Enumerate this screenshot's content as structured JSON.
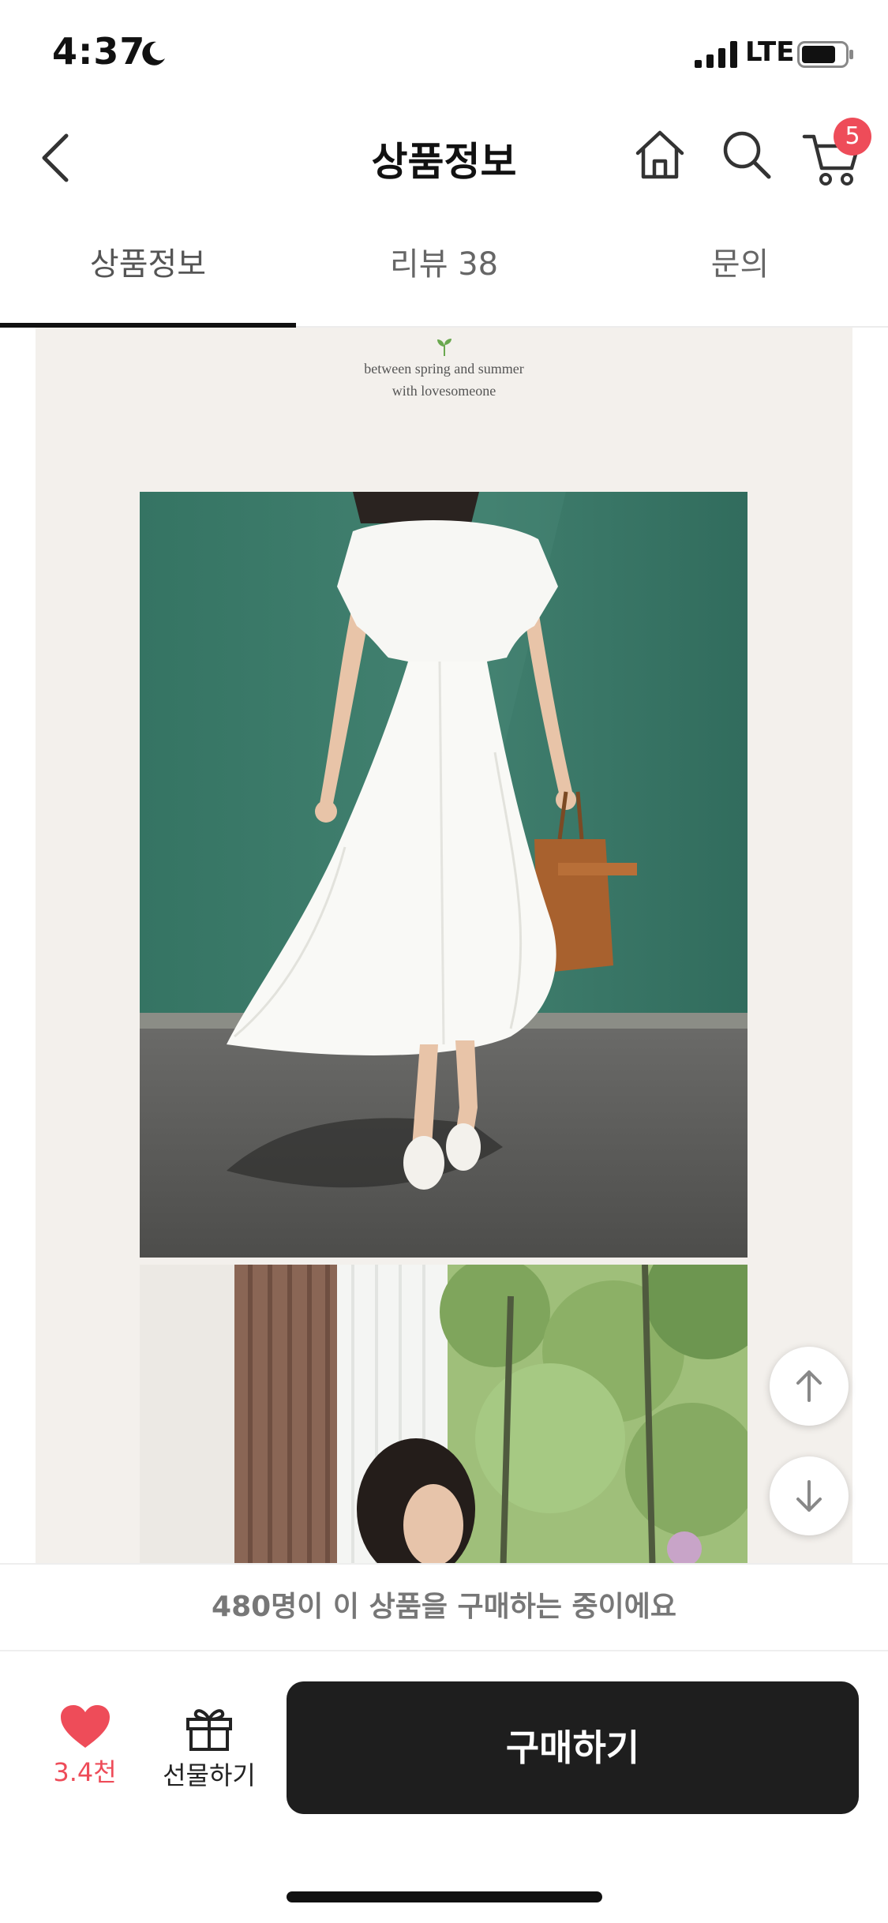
{
  "status_bar": {
    "time": "4:37",
    "network": "LTE"
  },
  "nav": {
    "title": "상품정보",
    "cart_count": "5"
  },
  "tabs": [
    {
      "label": "상품정보",
      "active": true
    },
    {
      "label": "리뷰 38",
      "active": false
    },
    {
      "label": "문의",
      "active": false
    }
  ],
  "content": {
    "tagline_line1": "between spring and summer",
    "tagline_line2": "with lovesomeone"
  },
  "notice": "480명이 이 상품을 구매하는 중이에요",
  "bottom_bar": {
    "like_count": "3.4천",
    "gift_label": "선물하기",
    "buy_label": "구매하기"
  },
  "colors": {
    "accent": "#ee4c59",
    "buy_button": "#1e1e1e",
    "content_background": "#f3f0ec",
    "wall_green": "#3c7a6b"
  },
  "icons": [
    "moon-icon",
    "signal-icon",
    "battery-icon",
    "back-arrow-icon",
    "home-icon",
    "search-icon",
    "cart-icon",
    "sprout-icon",
    "arrow-up-icon",
    "arrow-down-icon",
    "heart-icon",
    "gift-icon"
  ]
}
